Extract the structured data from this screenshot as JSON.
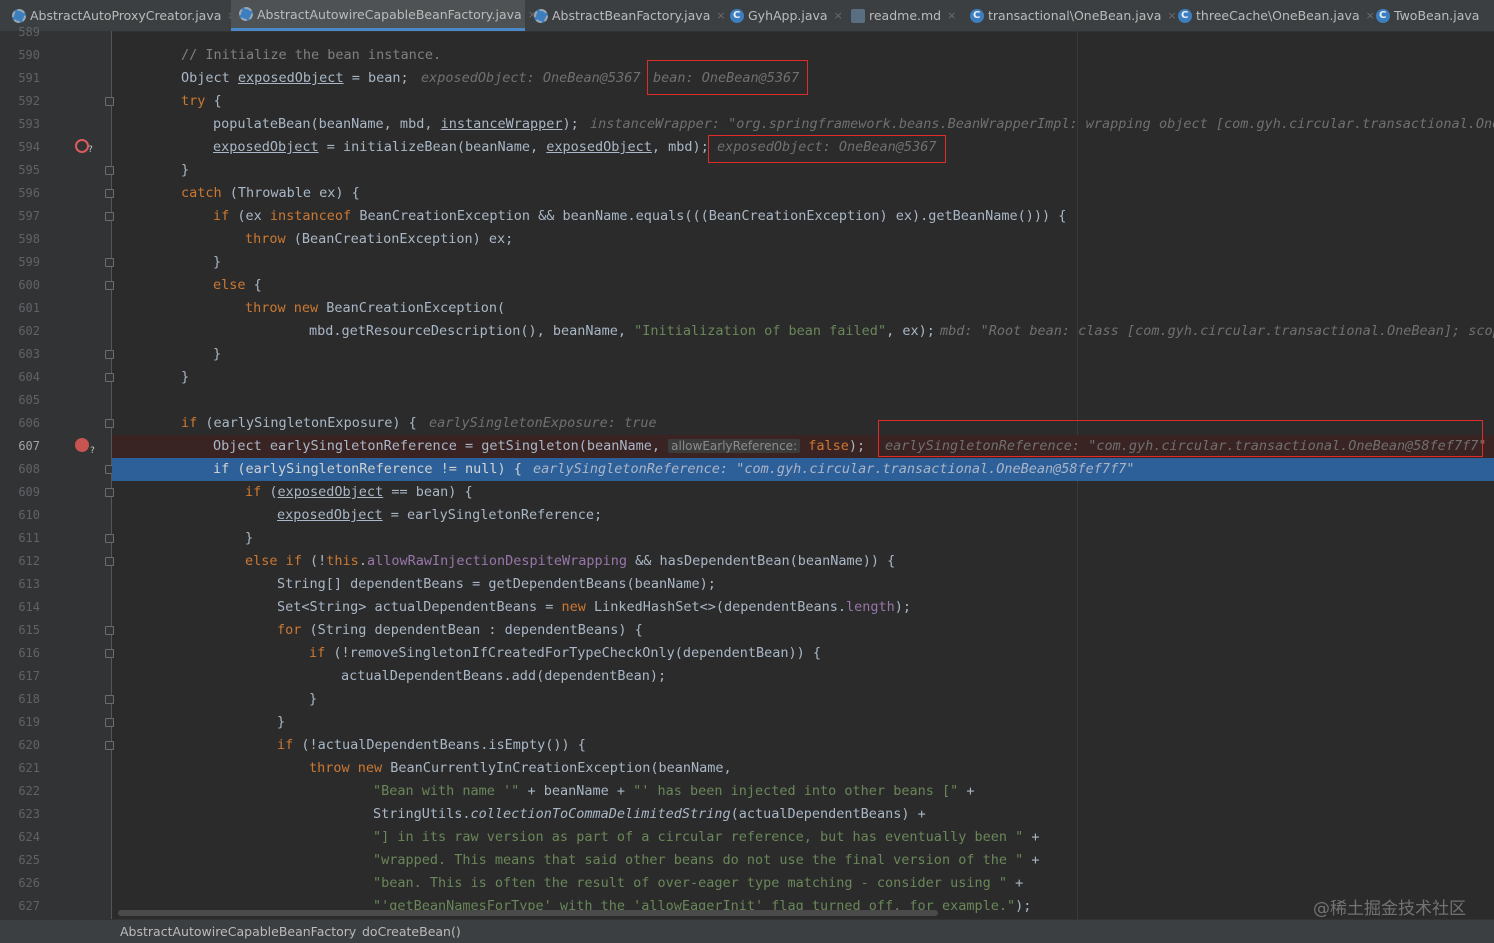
{
  "tabs": [
    {
      "label": "AbstractAutoProxyCreator.java",
      "icon": "abstract-class-icon",
      "active": false
    },
    {
      "label": "AbstractAutowireCapableBeanFactory.java",
      "icon": "abstract-class-icon",
      "active": true
    },
    {
      "label": "AbstractBeanFactory.java",
      "icon": "abstract-class-icon",
      "active": false
    },
    {
      "label": "GyhApp.java",
      "icon": "spring-class-icon",
      "active": false
    },
    {
      "label": "readme.md",
      "icon": "markdown-file-icon",
      "active": false
    },
    {
      "label": "transactional\\OneBean.java",
      "icon": "class-icon",
      "active": false
    },
    {
      "label": "threeCache\\OneBean.java",
      "icon": "class-icon",
      "active": false
    },
    {
      "label": "TwoBean.java",
      "icon": "class-icon",
      "active": false
    }
  ],
  "tab_close_glyph": "×",
  "gutter": {
    "line_numbers": [
      "589",
      "590",
      "591",
      "592",
      "593",
      "594",
      "595",
      "596",
      "597",
      "598",
      "599",
      "600",
      "601",
      "602",
      "603",
      "604",
      "605",
      "606",
      "607",
      "608",
      "609",
      "610",
      "611",
      "612",
      "613",
      "614",
      "615",
      "616",
      "617",
      "618",
      "619",
      "620",
      "621",
      "622",
      "623",
      "624",
      "625",
      "626",
      "627"
    ],
    "current_line": "607",
    "breakpoint_lines": [
      "594",
      "607"
    ],
    "breakpoint_check_mark": "?"
  },
  "code": {
    "l590": "// Initialize the bean instance.",
    "l591_a": "Object ",
    "l591_b": "exposedObject",
    "l591_c": " = bean;",
    "l591_inlay": "exposedObject: OneBean@5367",
    "l591_inlay2": "bean: OneBean@5367",
    "l592": "try",
    "l592_b": " {",
    "l593_a": "populateBean(beanName, mbd, ",
    "l593_b": "instanceWrapper",
    "l593_c": ");",
    "l593_inlay": "instanceWrapper: \"org.springframework.beans.BeanWrapperImpl: wrapping object [com.gyh.circular.transactional.OneB",
    "l594_a": "exposedObject",
    "l594_b": " = initializeBean(beanName, ",
    "l594_c": "exposedObject",
    "l594_d": ", mbd);",
    "l594_inlay": "exposedObject: OneBean@5367",
    "l595": "}",
    "l596_kw": "catch",
    "l596": " (Throwable ex) {",
    "l597_kw1": "if",
    "l597_a": " (ex ",
    "l597_kw2": "instanceof",
    "l597_b": " BeanCreationException && beanName.equals(((BeanCreationException) ex).getBeanName())) {",
    "l598_kw": "throw",
    "l598": " (BeanCreationException) ex;",
    "l599": "}",
    "l600_kw": "else",
    "l600": " {",
    "l601_kw1": "throw",
    "l601_kw2": "new",
    "l601": " BeanCreationException(",
    "l602_a": "mbd.getResourceDescription(), beanName, ",
    "l602_str": "\"Initialization of bean failed\"",
    "l602_b": ", ex);",
    "l602_inlay": "mbd: \"Root bean: class [com.gyh.circular.transactional.OneBean]; scop",
    "l603": "}",
    "l604": "}",
    "l606_kw": "if",
    "l606": " (earlySingletonExposure) {",
    "l606_inlay": "earlySingletonExposure: true",
    "l607_a": "Object earlySingletonReference = getSingleton(beanName, ",
    "l607_hint": "allowEarlyReference:",
    "l607_kw": " false",
    "l607_b": ");",
    "l607_inlay": "earlySingletonReference: \"com.gyh.circular.transactional.OneBean@58fef7f7\"",
    "l608_kw": "if",
    "l608_a": " (earlySingletonReference != ",
    "l608_null": "null",
    "l608_b": ") {",
    "l608_inlay": "earlySingletonReference: \"com.gyh.circular.transactional.OneBean@58fef7f7\"",
    "l609_kw": "if",
    "l609_a": " (",
    "l609_b": "exposedObject",
    "l609_c": " == bean) {",
    "l610_a": "exposedObject",
    "l610_b": " = earlySingletonReference;",
    "l611": "}",
    "l612_kw1": "else if",
    "l612_a": " (!",
    "l612_kw2": "this",
    "l612_b": ".",
    "l612_fld": "allowRawInjectionDespiteWrapping",
    "l612_c": " && hasDependentBean(beanName)) {",
    "l613": "String[] dependentBeans = getDependentBeans(beanName);",
    "l614_a": "Set<String> actualDependentBeans = ",
    "l614_kw": "new",
    "l614_b": " LinkedHashSet<>(dependentBeans.",
    "l614_fld": "length",
    "l614_c": ");",
    "l615_kw": "for",
    "l615": " (String dependentBean : dependentBeans) {",
    "l616_kw": "if",
    "l616": " (!removeSingletonIfCreatedForTypeCheckOnly(dependentBean)) {",
    "l617": "actualDependentBeans.add(dependentBean);",
    "l618": "}",
    "l619": "}",
    "l620_kw": "if",
    "l620": " (!actualDependentBeans.isEmpty()) {",
    "l621_kw1": "throw",
    "l621_kw2": "new",
    "l621": " BeanCurrentlyInCreationException(beanName,",
    "l622_str1": "\"Bean with name '\"",
    "l622_a": " + beanName + ",
    "l622_str2": "\"' has been injected into other beans [\"",
    "l622_b": " +",
    "l623_a": "StringUtils.",
    "l623_it": "collectionToCommaDelimitedString",
    "l623_b": "(actualDependentBeans) +",
    "l624_str": "\"] in its raw version as part of a circular reference, but has eventually been \"",
    "l624_b": " +",
    "l625_str": "\"wrapped. This means that said other beans do not use the final version of the \"",
    "l625_b": " +",
    "l626_str": "\"bean. This is often the result of over-eager type matching - consider using \"",
    "l626_b": " +",
    "l627_str": "\"'getBeanNamesForType' with the 'allowEagerInit' flag turned off, for example.\"",
    "l627_b": ");"
  },
  "breadcrumb": {
    "class_name": "AbstractAutowireCapableBeanFactory",
    "separator": "›",
    "method_name": "doCreateBean()"
  },
  "watermark": "@稀土掘金技术社区",
  "colors": {
    "keyword": "#cc7832",
    "string": "#6a8759",
    "comment": "#808080",
    "field": "#9876aa",
    "execution_line": "#2d6099",
    "annotation_box": "#e02b2b"
  }
}
